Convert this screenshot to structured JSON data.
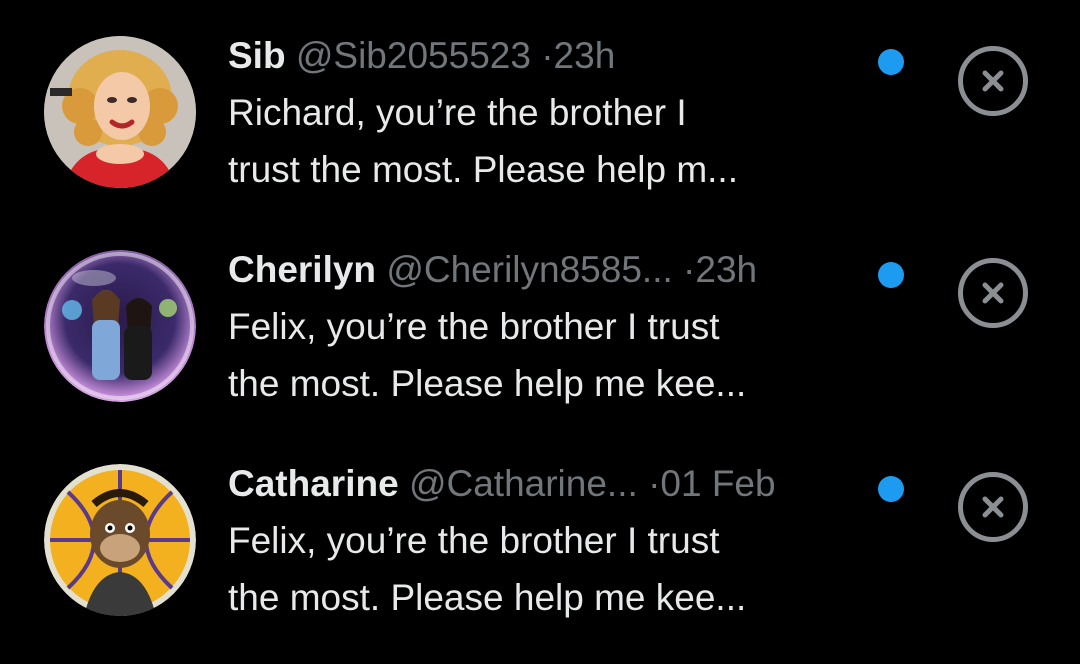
{
  "theme": {
    "background": "#000000",
    "primary_text": "#e7e9ea",
    "secondary_text": "#71767b",
    "unread_dot": "#1d9bf0",
    "dismiss_ring": "#8b8f94"
  },
  "conversations": [
    {
      "name": "Sib",
      "handle": "@Sib2055523",
      "separator": "·",
      "time": "23h",
      "preview_line_1": "Richard, you’re the brother I",
      "preview_line_2": "trust the most. Please help m...",
      "avatar_icon": "avatar-cartoon-woman-red-dress",
      "unread": true,
      "dismiss_icon": "close-circle-icon"
    },
    {
      "name": "Cherilyn",
      "handle": "@Cherilyn8585...",
      "separator": "·",
      "time": "23h",
      "preview_line_1": "Felix, you’re the brother I trust",
      "preview_line_2": "the most. Please help me kee...",
      "avatar_icon": "avatar-photo-couple-bubble",
      "unread": true,
      "dismiss_icon": "close-circle-icon"
    },
    {
      "name": "Catharine",
      "handle": "@Catharine...",
      "separator": "·",
      "time": "01 Feb",
      "preview_line_1": "Felix, you’re the brother I trust",
      "preview_line_2": "the most. Please help me kee...",
      "avatar_icon": "avatar-ape-nft",
      "unread": true,
      "dismiss_icon": "close-circle-icon"
    }
  ]
}
